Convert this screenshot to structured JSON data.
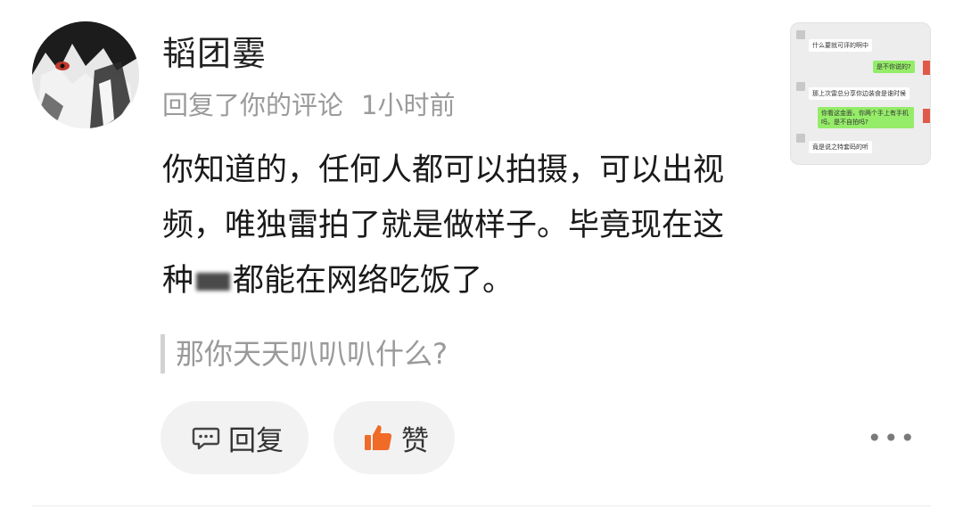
{
  "comment": {
    "username": "韬团霎",
    "action": "回复了你的评论",
    "time": "1小时前",
    "text_part1": "你知道的，任何人都可以拍摄，可以出视频，唯独雷拍了就是做样子。毕竟现在这种",
    "text_part2": "都能在网络吃饭了。",
    "quoted_reply": "那你天天叭叭叭什么?"
  },
  "actions": {
    "reply_label": "回复",
    "like_label": "赞",
    "more_label": "•••"
  },
  "thumbnail_chat": {
    "messages": [
      "什么要就可评的啊中",
      "是不你说的?",
      "那上次雷总分享你边装食是谁时候",
      "你看这金面，你两个手上有手机吗，是不自拍吗?",
      "竟是说之特套码的听"
    ]
  },
  "colors": {
    "like_icon": "#f06a28",
    "pill_bg": "#f2f2f2",
    "secondary_text": "#9a9a9a"
  }
}
